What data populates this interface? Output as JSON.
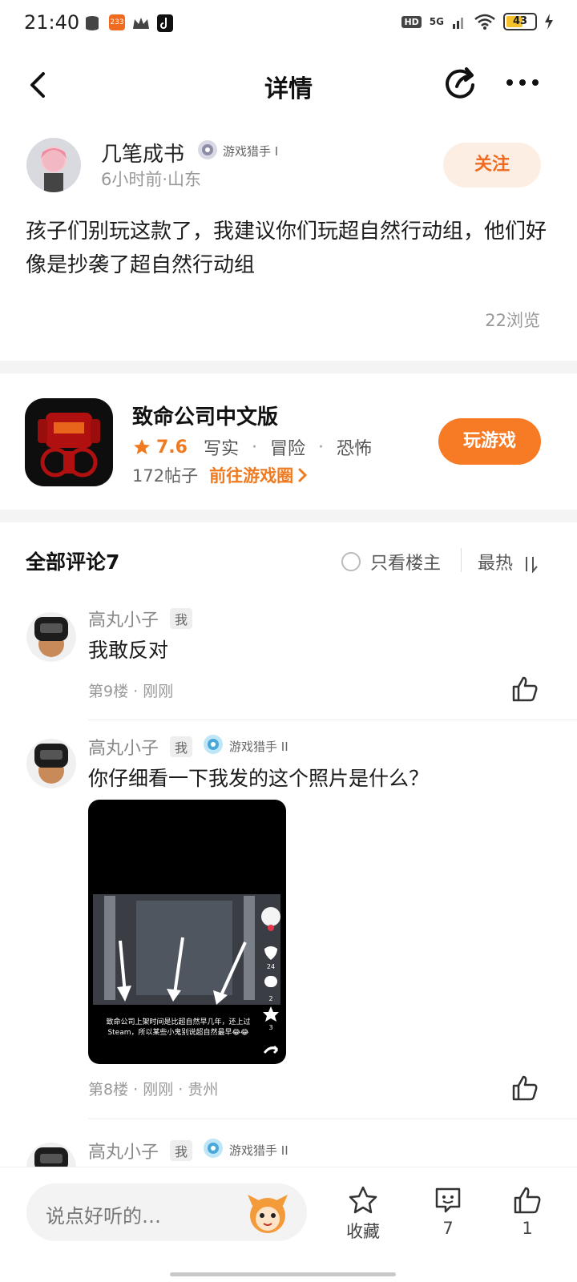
{
  "status_bar": {
    "time": "21:40",
    "network": "5G",
    "hd": "HD",
    "battery": "43",
    "notif_badge": "233",
    "icons": [
      "database-icon",
      "app-badge-icon",
      "crown-icon",
      "tiktok-icon",
      "hd-icon",
      "signal-icon",
      "wifi-icon",
      "battery-icon",
      "charging-icon"
    ]
  },
  "nav": {
    "title": "详情",
    "icons": [
      "back-icon",
      "share-icon",
      "more-icon"
    ]
  },
  "post": {
    "author": "几笔成书",
    "author_badge": "游戏猎手 I",
    "meta": "6小时前·山东",
    "follow_label": "关注",
    "body": "孩子们别玩这款了，我建议你们玩超自然行动组，他们好像是抄袭了超自然行动组",
    "views": "22浏览"
  },
  "game": {
    "title": "致命公司中文版",
    "rating": "7.6",
    "tags": [
      "写实",
      "冒险",
      "恐怖"
    ],
    "posts": "172帖子",
    "goto_label": "前往游戏圈",
    "play_label": "玩游戏",
    "icon": "game-icon"
  },
  "comments_header": {
    "title": "全部评论7",
    "only_owner_label": "只看楼主",
    "sort_label": "最热"
  },
  "comments": [
    {
      "name": "高丸小子",
      "me_tag": "我",
      "text": "我敢反对",
      "meta": "第9楼 · 刚刚"
    },
    {
      "name": "高丸小子",
      "me_tag": "我",
      "badge": "游戏猎手 II",
      "text": "你仔细看一下我发的这个照片是什么？",
      "image_caption": "致命公司上架时间是比超自然早几年，还上过Steam，所以某些小鬼别说超自然最早😂😂",
      "image_counts": [
        "24",
        "2",
        "3"
      ],
      "meta": "第8楼 · 刚刚 · 贵州"
    },
    {
      "name": "高丸小子",
      "me_tag": "我",
      "badge": "游戏猎手 II"
    }
  ],
  "bottom_bar": {
    "input_placeholder": "说点好听的…",
    "favorite_label": "收藏",
    "comment_count": "7",
    "like_count": "1"
  },
  "colors": {
    "accent": "#f77a24",
    "follow_bg": "#fdeee4",
    "text_muted": "#999999"
  }
}
